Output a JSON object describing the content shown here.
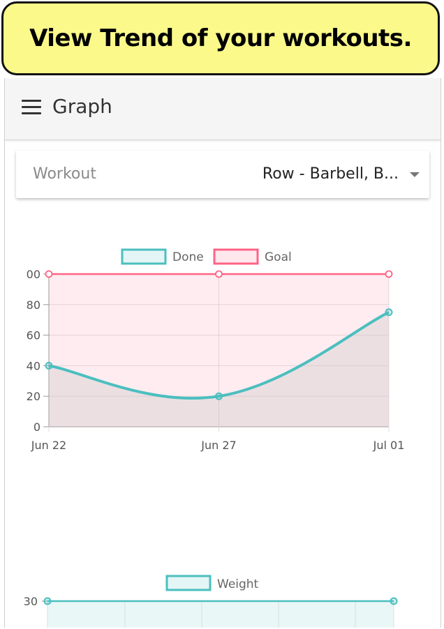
{
  "banner": {
    "text": "View Trend of your workouts."
  },
  "appbar": {
    "title": "Graph",
    "menu_icon": "menu-icon"
  },
  "workout_select": {
    "label": "Workout",
    "value": "Row - Barbell, B..."
  },
  "colors": {
    "done": "#4bbfbf",
    "goal": "#ff6384",
    "weight": "#4bbfbf"
  },
  "chart_data": [
    {
      "type": "line",
      "x": [
        "Jun 22",
        "Jun 27",
        "Jul 01"
      ],
      "y_ticks": [
        "0",
        "20",
        "40",
        "60",
        "80",
        "00"
      ],
      "ylim": [
        0,
        100
      ],
      "legend_position": "top",
      "series": [
        {
          "name": "Done",
          "values": [
            40,
            20,
            75
          ],
          "fill": true
        },
        {
          "name": "Goal",
          "values": [
            100,
            100,
            100
          ],
          "fill": true
        }
      ]
    },
    {
      "type": "line",
      "visible_tick": "30",
      "legend_position": "top",
      "series": [
        {
          "name": "Weight",
          "values": [
            30,
            30
          ]
        }
      ]
    }
  ]
}
